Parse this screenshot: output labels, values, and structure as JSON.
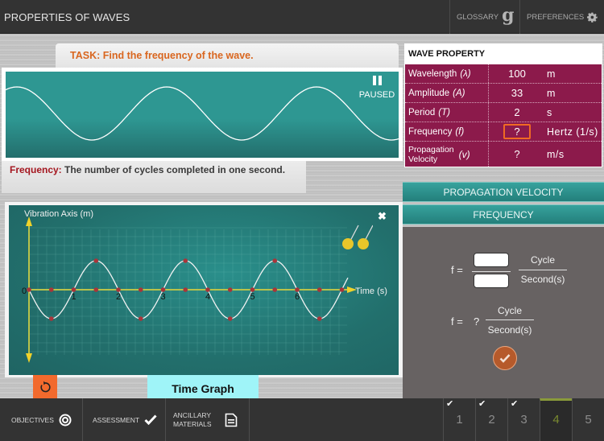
{
  "header": {
    "title": "PROPERTIES OF WAVES",
    "glossary_label": "GLOSSARY",
    "glossary_icon": "g-glyph-icon",
    "preferences_label": "PREFERENCES",
    "preferences_icon": "gear-icon"
  },
  "task": {
    "text": "TASK: Find the frequency of the wave."
  },
  "animation": {
    "status_label": "PAUSED",
    "status_icon": "pause-icon"
  },
  "definition": {
    "term": "Frequency:",
    "text": " The number of cycles completed in one second."
  },
  "wave_property": {
    "title": "WAVE PROPERTY",
    "rows": [
      {
        "name": "Wavelength",
        "symbol": "(λ)",
        "value": "100",
        "unit": "m"
      },
      {
        "name": "Amplitude",
        "symbol": "(A)",
        "value": "33",
        "unit": "m"
      },
      {
        "name": "Period",
        "symbol": "(T)",
        "value": "2",
        "unit": "s"
      },
      {
        "name": "Frequency",
        "symbol": "(f)",
        "value": "?",
        "unit": "Hertz (1/s)"
      },
      {
        "name_line1": "Propagation",
        "name_line2": "Velocity",
        "symbol": "(v)",
        "value": "?",
        "unit": "m/s"
      }
    ]
  },
  "formula_tabs": {
    "propagation_velocity": "PROPAGATION VELOCITY",
    "frequency": "FREQUENCY"
  },
  "calculator": {
    "f_label": "f =",
    "numerator_value": "",
    "denominator_value": "",
    "unit_numerator": "Cycle",
    "unit_denominator": "Second(s)",
    "result_label": "f =",
    "result_value": "?",
    "result_unit_numerator": "Cycle",
    "result_unit_denominator": "Second(s)"
  },
  "graph": {
    "y_axis_label": "Vibration Axis (m)",
    "x_axis_label": "Time (s)",
    "x_ticks": [
      "0",
      "1",
      "2",
      "3",
      "4",
      "5",
      "6"
    ],
    "period_s": 2,
    "close_icon": "close-icon",
    "tool_icon": "pins-icon"
  },
  "graph_tab": {
    "label": "Time Graph"
  },
  "reset_icon": "reset-icon",
  "footer": {
    "objectives": "OBJECTIVES",
    "assessment": "ASSESSMENT",
    "ancillary": "ANCILLARY MATERIALS",
    "steps": [
      {
        "label": "1",
        "completed": true
      },
      {
        "label": "2",
        "completed": true
      },
      {
        "label": "3",
        "completed": true
      },
      {
        "label": "4",
        "completed": false,
        "active": true
      },
      {
        "label": "5",
        "completed": false
      }
    ]
  },
  "colors": {
    "accent_teal": "#2e9792",
    "table_maroon": "#8c1a4b",
    "task_orange": "#d9661f",
    "term_red": "#a4161f",
    "reset_orange": "#f26a2d",
    "active_step": "#8a9a3a"
  }
}
